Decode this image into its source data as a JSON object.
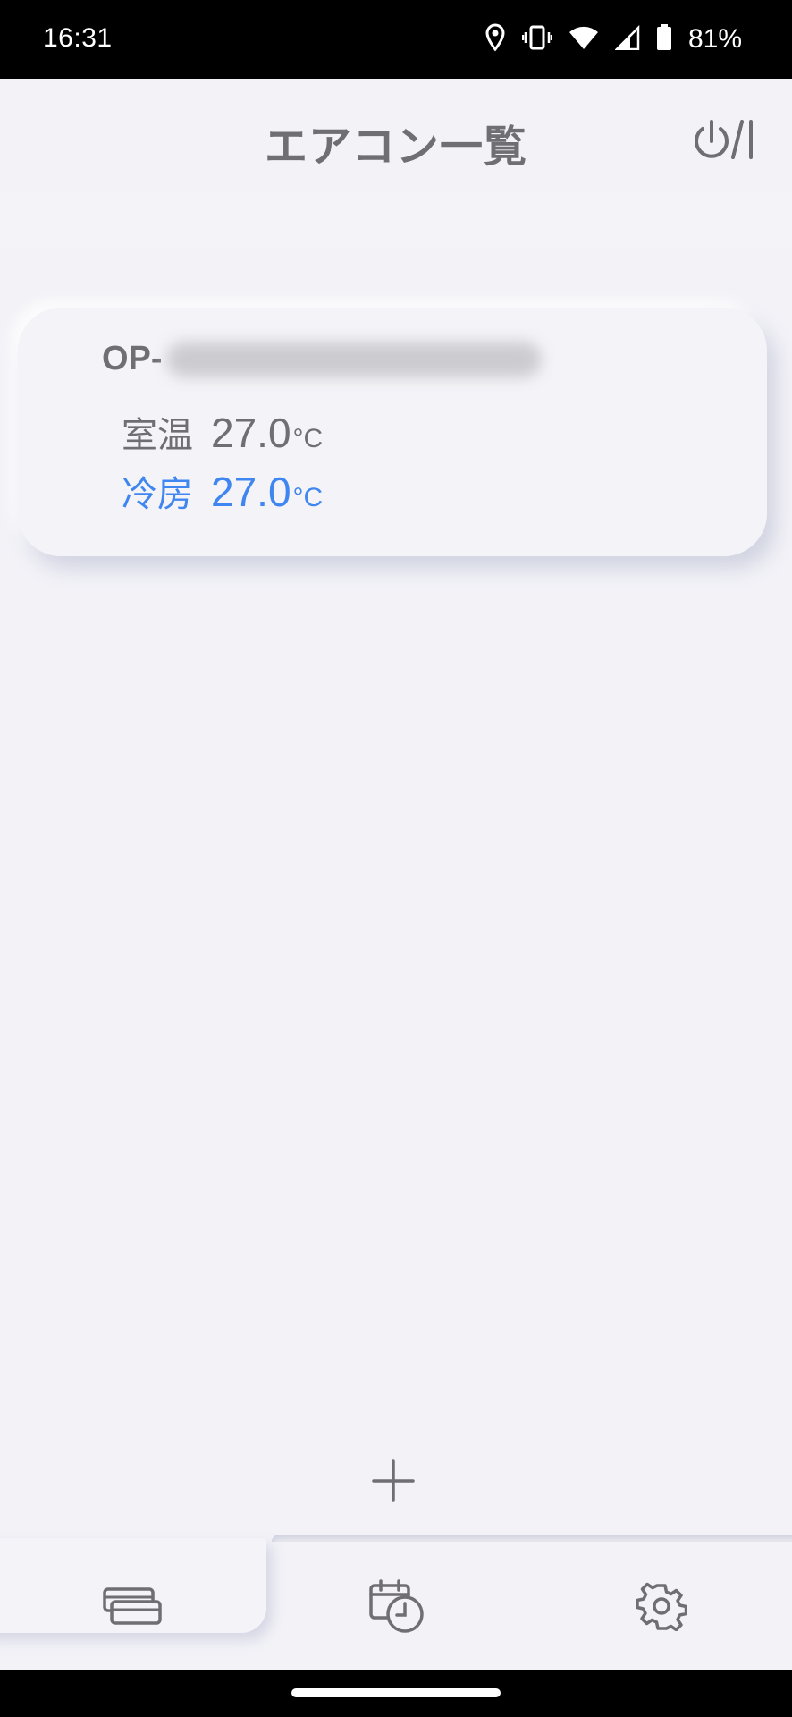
{
  "status_bar": {
    "time": "16:31",
    "battery": "81%",
    "icons": [
      "location-icon",
      "vibrate-icon",
      "wifi-icon",
      "signal-icon",
      "battery-icon"
    ]
  },
  "header": {
    "title": "エアコン一覧",
    "power_icon": "power-toggle-icon"
  },
  "aircons": [
    {
      "name_prefix": "OP-",
      "room_label": "室温",
      "room_temp": "27.0",
      "mode_label": "冷房",
      "set_temp": "27.0",
      "unit": "°C"
    }
  ],
  "add_icon": "plus-icon",
  "bottom_nav": {
    "active": "aircon-list",
    "items": [
      "aircon-list-icon",
      "timer-schedule-icon",
      "settings-gear-icon"
    ]
  },
  "colors": {
    "background": "#f2f2f7",
    "text_gray": "#6e6e73",
    "accent_blue": "#3f86f0"
  }
}
